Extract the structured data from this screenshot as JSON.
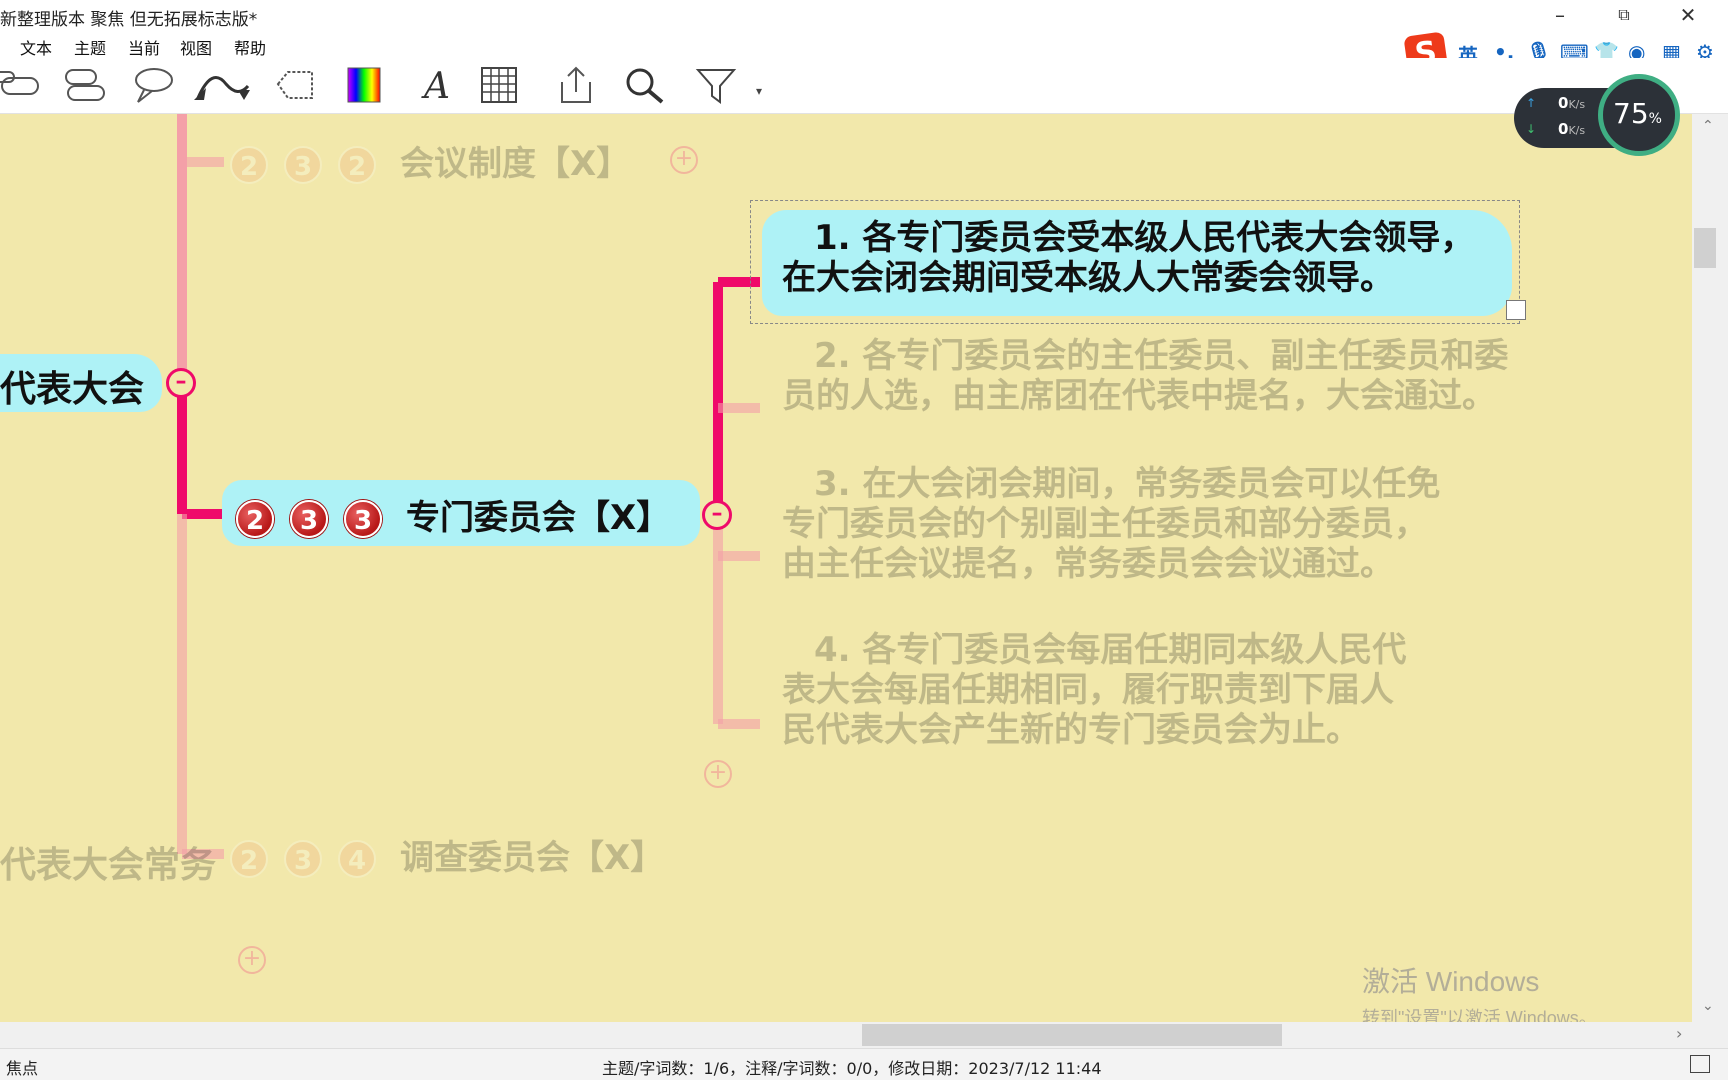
{
  "window": {
    "title": "新整理版本 聚焦 但无拓展标志版*"
  },
  "menu": [
    "文本",
    "主题",
    "当前",
    "视图",
    "帮助"
  ],
  "ime": {
    "lang": "英",
    "punct": "•,",
    "ime_logo": "S"
  },
  "network": {
    "up": "0",
    "down": "0",
    "unit": "K/s",
    "percent": "75",
    "percent_sign": "%"
  },
  "mindmap": {
    "left_parent": "代表大会",
    "left_bottom": "代表大会常务",
    "faded_top": {
      "badges": [
        "2",
        "3",
        "2"
      ],
      "label": "会议制度【X】"
    },
    "main": {
      "badges": [
        "2",
        "3",
        "3"
      ],
      "label": "专门委员会【X】"
    },
    "faded_bottom": {
      "badges": [
        "2",
        "3",
        "4"
      ],
      "label": "调查委员会【X】"
    },
    "items": [
      {
        "line1": "1. 各专门委员会受本级人民代表大会领导，",
        "line2": "在大会闭会期间受本级人大常委会领导。"
      },
      {
        "line1": "2. 各专门委员会的主任委员、副主任委员和委",
        "line2": "员的人选，由主席团在代表中提名，大会通过。"
      },
      {
        "line1": "3. 在大会闭会期间，常务委员会可以任免",
        "line2": "专门委员会的个别副主任委员和部分委员，",
        "line3": "由主任会议提名，常务委员会会议通过。"
      },
      {
        "line1": "4. 各专门委员会每届任期同本级人民代",
        "line2": "表大会每届任期相同，履行职责到下届人",
        "line3": "民代表大会产生新的专门委员会为止。"
      }
    ]
  },
  "watermark": {
    "line1": "激活 Windows",
    "line2": "转到\"设置\"以激活 Windows。"
  },
  "status": {
    "left": "焦点",
    "center": "主题/字词数：1/6，注释/字词数：0/0，修改日期：2023/7/12 11:44"
  },
  "colors": {
    "canvas": "#f2e8ab",
    "bubble": "#aef2f6",
    "connector": "#ef0a6a"
  }
}
